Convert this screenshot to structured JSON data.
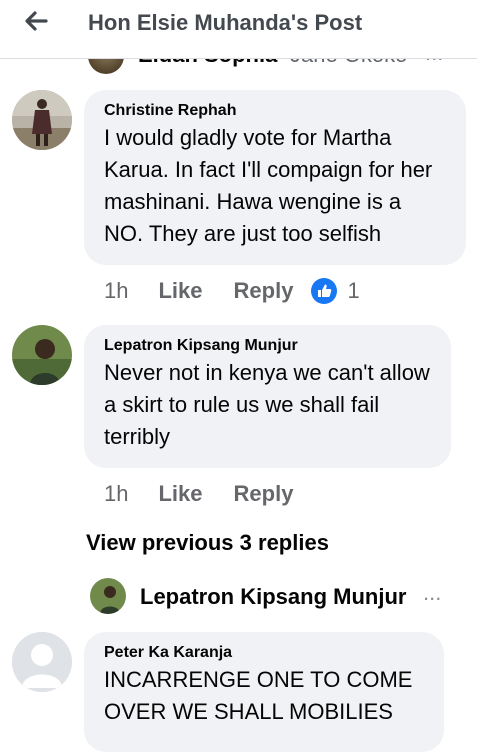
{
  "header": {
    "title": "Hon Elsie Muhanda's Post"
  },
  "previous_row": {
    "name": "Eldah Sophia",
    "sub": "Jane Okoko",
    "more": "..."
  },
  "comments": [
    {
      "author": "Christine Rephah",
      "text": "I would gladly vote for Martha Karua. In fact I'll compaign for her mashinani. Hawa wengine is a NO.  They are just too selfish",
      "time": "1h",
      "like_label": "Like",
      "reply_label": "Reply",
      "reaction_count": "1"
    },
    {
      "author": "Lepatron Kipsang Munjur",
      "text": "Never not in kenya we can't allow a skirt to rule us we shall fail terribly",
      "time": "1h",
      "like_label": "Like",
      "reply_label": "Reply"
    },
    {
      "author": "Peter Ka Karanja",
      "text": "INCARRENGE ONE TO COME OVER WE SHALL MOBILIES"
    }
  ],
  "view_previous": "View previous 3 replies",
  "reply_row": {
    "name": "Lepatron Kipsang Munjur",
    "more": "..."
  },
  "colors": {
    "bubble": "#f0f2f5",
    "like_blue": "#1877f2",
    "meta_gray": "#65676b"
  }
}
